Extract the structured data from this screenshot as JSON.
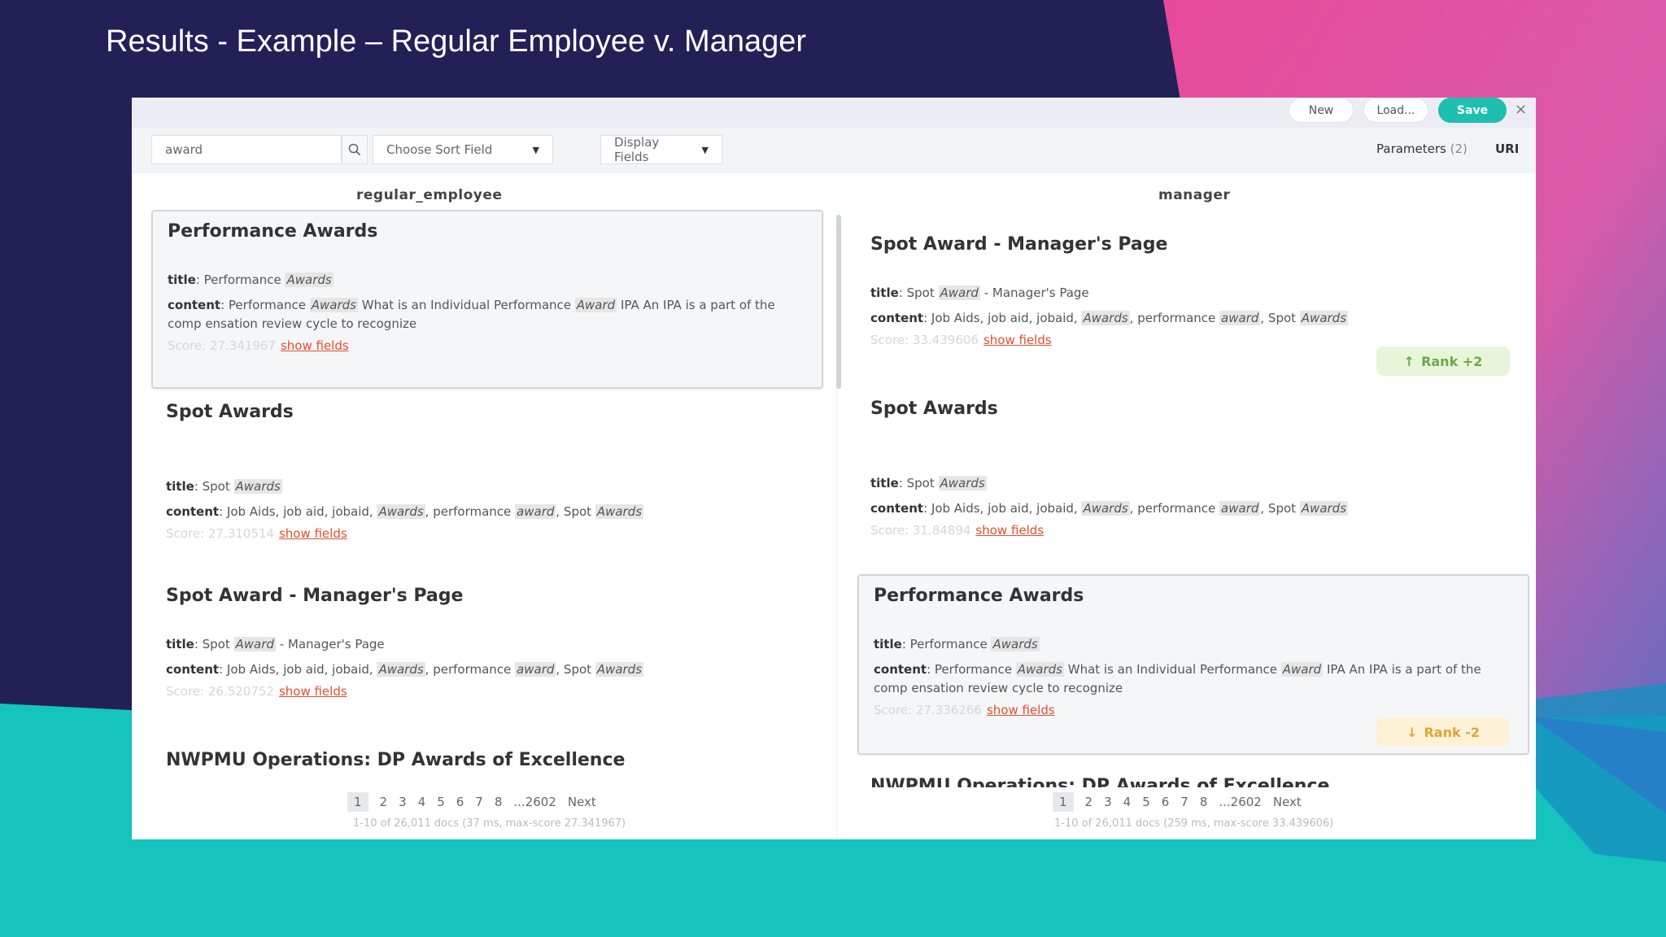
{
  "slide": {
    "title": "Results - Example – Regular Employee v. Manager"
  },
  "colors": {
    "background": "#232058",
    "pink": "#e84a9a",
    "teal": "#14c4bd",
    "save_button": "#1dbfb0",
    "show_fields_link": "#e64d2d",
    "rank_up": "#6aa84a",
    "rank_down": "#e0a43a"
  },
  "topbar": {
    "new_label": "New",
    "load_label": "Load...",
    "save_label": "Save",
    "close_label": "×"
  },
  "toolbar": {
    "search_value": "award",
    "sort_label": "Choose Sort Field",
    "display_label": "Display Fields",
    "params_label": "Parameters",
    "params_count": "(2)",
    "uri_label": "URI"
  },
  "columns": {
    "left_header": "regular_employee",
    "right_header": "manager"
  },
  "left_results": [
    {
      "title": "Performance Awards",
      "title_field": {
        "label": "title",
        "pre": "Performance ",
        "hl": "Awards",
        "post": ""
      },
      "content_field": {
        "label": "content",
        "text1": "Performance ",
        "hl1": "Awards",
        "text2": " What is an Individual Performance ",
        "hl2": "Award",
        "text3": " IPA An IPA is a part of the comp ensation review cycle to recognize"
      },
      "score": "Score: 27.341967",
      "show_fields": "show fields"
    },
    {
      "title": "Spot Awards",
      "title_field": {
        "label": "title",
        "pre": "Spot ",
        "hl": "Awards",
        "post": ""
      },
      "content_field": {
        "label": "content",
        "text1": "Job Aids, job aid, jobaid, ",
        "hl1": "Awards",
        "text2": ", performance ",
        "hl2": "award",
        "text3": ", Spot ",
        "hl3": "Awards"
      },
      "score": "Score: 27.310514",
      "show_fields": "show fields"
    },
    {
      "title": "Spot Award - Manager's Page",
      "title_field": {
        "label": "title",
        "pre": "Spot ",
        "hl": "Award",
        "post": " - Manager's Page"
      },
      "content_field": {
        "label": "content",
        "text1": "Job Aids, job aid, jobaid, ",
        "hl1": "Awards",
        "text2": ", performance ",
        "hl2": "award",
        "text3": ", Spot ",
        "hl3": "Awards"
      },
      "score": "Score: 26.520752",
      "show_fields": "show fields"
    },
    {
      "title": "NWPMU Operations: DP Awards of Excellence"
    }
  ],
  "right_results": [
    {
      "title": "Spot Award - Manager's Page",
      "title_field": {
        "label": "title",
        "pre": "Spot ",
        "hl": "Award",
        "post": " - Manager's Page"
      },
      "content_field": {
        "label": "content",
        "text1": "Job Aids, job aid, jobaid, ",
        "hl1": "Awards",
        "text2": ", performance ",
        "hl2": "award",
        "text3": ", Spot ",
        "hl3": "Awards"
      },
      "score": "Score: 33.439606",
      "show_fields": "show fields",
      "rank": "Rank +2"
    },
    {
      "title": "Spot Awards",
      "title_field": {
        "label": "title",
        "pre": "Spot ",
        "hl": "Awards",
        "post": ""
      },
      "content_field": {
        "label": "content",
        "text1": "Job Aids, job aid, jobaid, ",
        "hl1": "Awards",
        "text2": ", performance ",
        "hl2": "award",
        "text3": ", Spot ",
        "hl3": "Awards"
      },
      "score": "Score: 31.84894",
      "show_fields": "show fields"
    },
    {
      "title": "Performance Awards",
      "title_field": {
        "label": "title",
        "pre": "Performance ",
        "hl": "Awards",
        "post": ""
      },
      "content_field": {
        "label": "content",
        "text1": "Performance ",
        "hl1": "Awards",
        "text2": " What is an Individual Performance ",
        "hl2": "Award",
        "text3": " IPA An IPA is a part of the comp ensation review cycle to recognize"
      },
      "score": "Score: 27.336266",
      "show_fields": "show fields",
      "rank": "Rank -2"
    },
    {
      "title": "NWPMU Operations: DP Awards of Excellence"
    }
  ],
  "pagination": {
    "pages": [
      "1",
      "2",
      "3",
      "4",
      "5",
      "6",
      "7",
      "8",
      "...2602"
    ],
    "next": "Next",
    "left_meta": "1-10 of 26,011 docs (37 ms, max-score 27.341967)",
    "right_meta": "1-10 of 26,011 docs (259 ms, max-score 33.439606)"
  }
}
